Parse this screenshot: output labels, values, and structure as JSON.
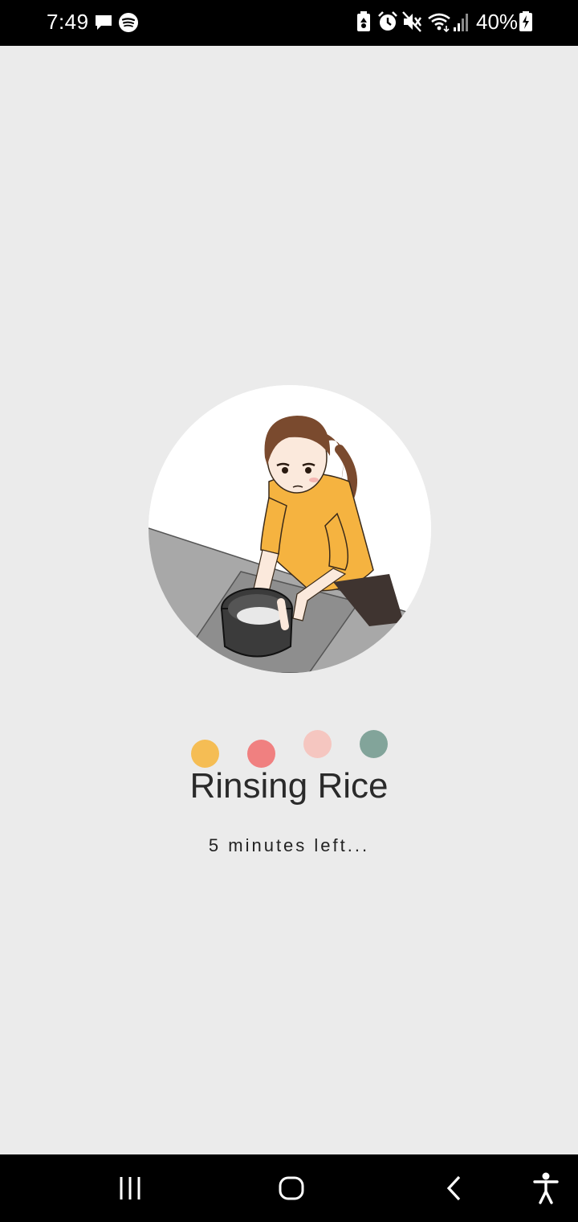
{
  "status_bar": {
    "time": "7:49",
    "battery_percent": "40%",
    "left_icons": [
      "message-icon",
      "spotify-icon"
    ],
    "right_icons": [
      "battery-saver-icon",
      "alarm-icon",
      "mute-icon",
      "wifi-icon",
      "signal-icon",
      "battery-charging-icon"
    ]
  },
  "main": {
    "illustration_icon": "person-rinsing-rice-illustration",
    "loading_dots": [
      {
        "color": "#f5bd54"
      },
      {
        "color": "#f08080"
      },
      {
        "color": "#f5c6c0"
      },
      {
        "color": "#82a49a"
      }
    ],
    "step_title": "Rinsing Rice",
    "time_left": "5 minutes left..."
  },
  "nav_bar": {
    "icons": [
      "recent-apps-icon",
      "home-icon",
      "back-icon",
      "accessibility-icon"
    ]
  }
}
